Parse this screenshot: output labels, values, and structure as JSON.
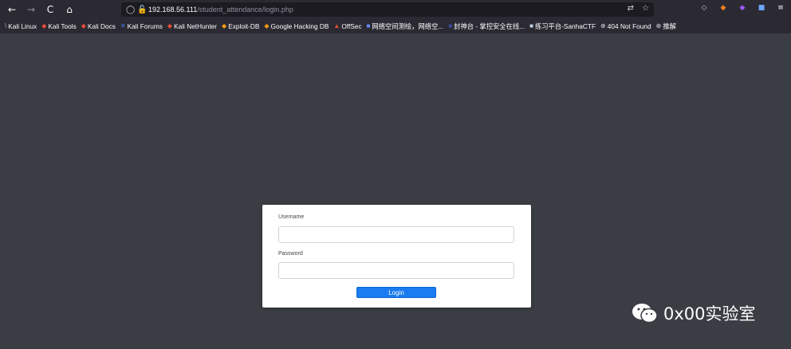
{
  "browser": {
    "url_host": "192.168.56.111",
    "url_path": "/student_attendance/login.php",
    "icons": {
      "back": "←",
      "forward": "→",
      "reload": "C",
      "home": "⌂",
      "shield": "◯",
      "lock": "🔓",
      "translate": "⇄",
      "star": "☆",
      "pocket": "◇",
      "menu": "≡"
    }
  },
  "bookmarks": [
    {
      "label": "Kali Linux",
      "icon": "\\"
    },
    {
      "label": "Kali Tools",
      "icon": "◆"
    },
    {
      "label": "Kali Docs",
      "icon": "◆"
    },
    {
      "label": "Kali Forums",
      "icon": "✕"
    },
    {
      "label": "Kali NetHunter",
      "icon": "◆"
    },
    {
      "label": "Exploit-DB",
      "icon": "◆"
    },
    {
      "label": "Google Hacking DB",
      "icon": "◆"
    },
    {
      "label": "OffSec",
      "icon": "▲"
    },
    {
      "label": "网络空间测绘，网络空...",
      "icon": "■"
    },
    {
      "label": "封神台 - 掌控安全在线...",
      "icon": "■"
    },
    {
      "label": "练习平台-SanhaCTF",
      "icon": "■"
    },
    {
      "label": "404 Not Found",
      "icon": "⊕"
    },
    {
      "label": "推解",
      "icon": "⊕"
    }
  ],
  "login": {
    "username_label": "Username",
    "password_label": "Password",
    "username_value": "",
    "password_value": "",
    "submit_label": "Login"
  },
  "watermark": {
    "text": "0x00实验室"
  },
  "colors": {
    "page_bg": "#3a3d43",
    "chrome_bg": "#2b2a33",
    "button_blue": "#1a7cf0"
  }
}
